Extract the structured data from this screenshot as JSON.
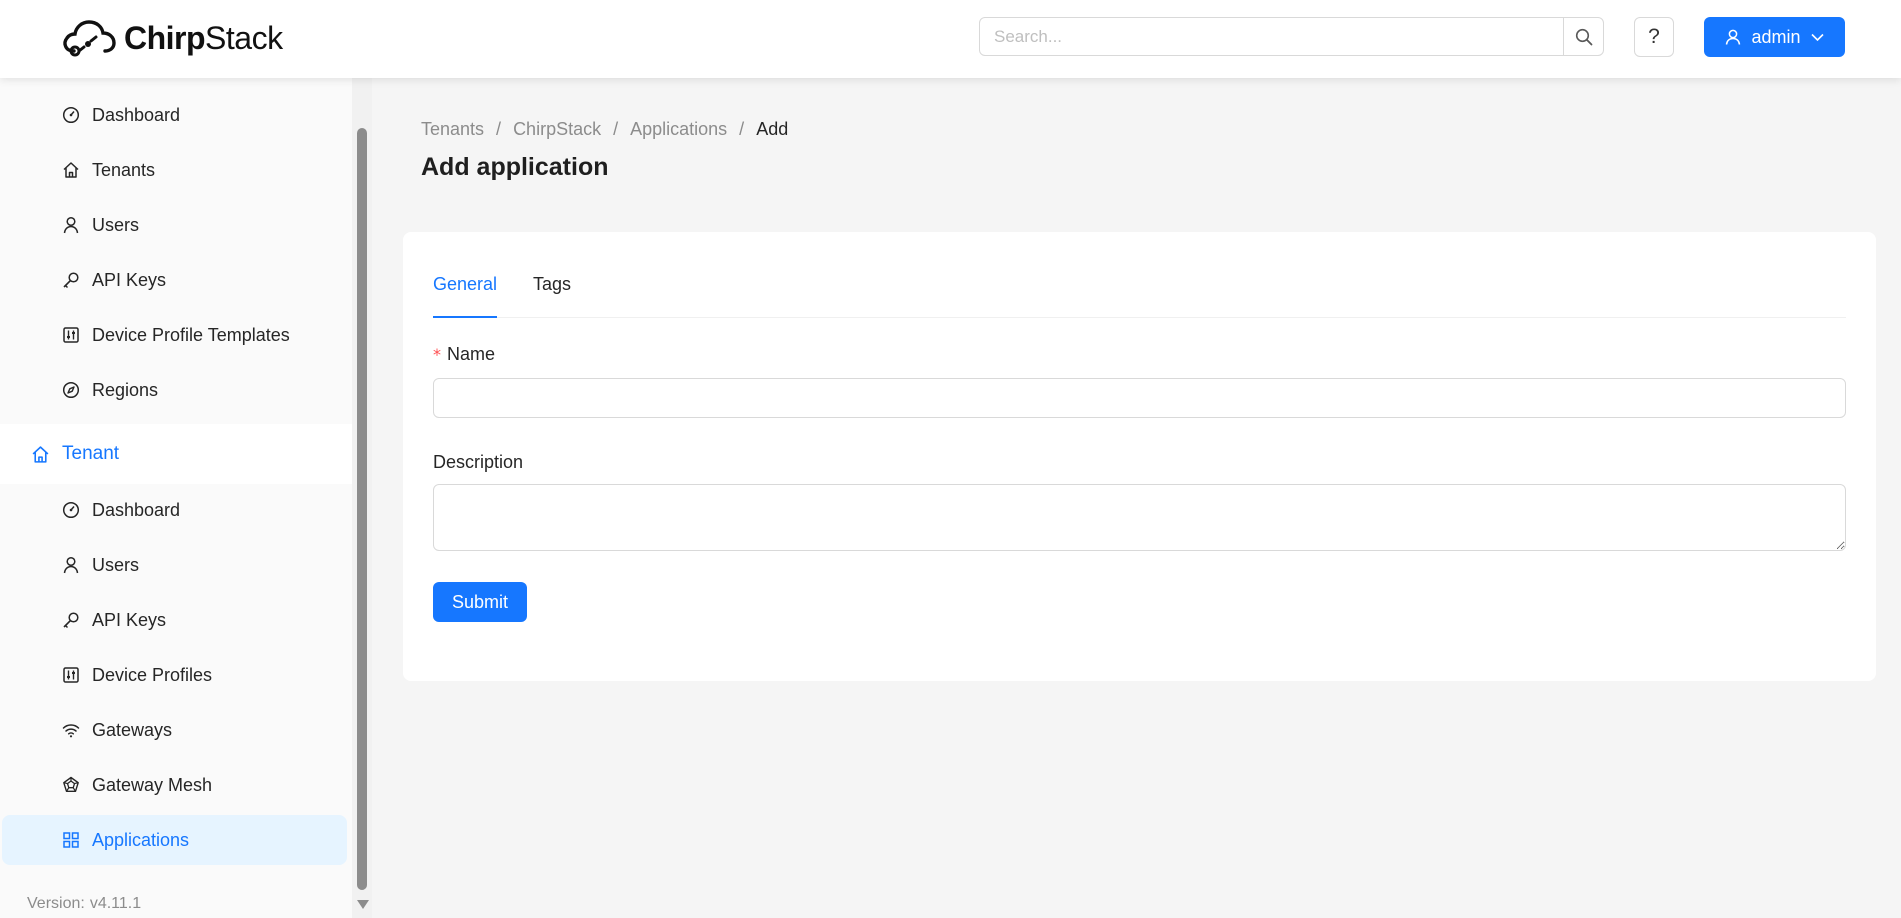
{
  "header": {
    "logo_text_bold": "Chirp",
    "logo_text_regular": "Stack",
    "search_placeholder": "Search...",
    "help_label": "?",
    "user_label": "admin",
    "accent_color": "#1677ff"
  },
  "sidebar": {
    "network_items": [
      {
        "label": "Dashboard",
        "icon": "dashboard-icon"
      },
      {
        "label": "Tenants",
        "icon": "home-icon"
      },
      {
        "label": "Users",
        "icon": "user-icon"
      },
      {
        "label": "API Keys",
        "icon": "key-icon"
      },
      {
        "label": "Device Profile Templates",
        "icon": "sliders-icon"
      },
      {
        "label": "Regions",
        "icon": "compass-icon"
      }
    ],
    "tenant_group": {
      "label": "Tenant",
      "icon": "home-icon"
    },
    "tenant_items": [
      {
        "label": "Dashboard",
        "icon": "dashboard-icon"
      },
      {
        "label": "Users",
        "icon": "user-icon"
      },
      {
        "label": "API Keys",
        "icon": "key-icon"
      },
      {
        "label": "Device Profiles",
        "icon": "sliders-icon"
      },
      {
        "label": "Gateways",
        "icon": "wifi-icon"
      },
      {
        "label": "Gateway Mesh",
        "icon": "mesh-icon"
      },
      {
        "label": "Applications",
        "icon": "grid-icon",
        "selected": true
      }
    ],
    "version_label": "Version:",
    "version_value": "v4.11.1"
  },
  "breadcrumb": {
    "items": [
      "Tenants",
      "ChirpStack",
      "Applications",
      "Add"
    ],
    "separator": "/"
  },
  "page": {
    "title": "Add application"
  },
  "form": {
    "tabs": [
      "General",
      "Tags"
    ],
    "active_tab": "General",
    "name_label": "Name",
    "name_required_mark": "*",
    "name_value": "",
    "description_label": "Description",
    "description_value": "",
    "submit_label": "Submit"
  }
}
